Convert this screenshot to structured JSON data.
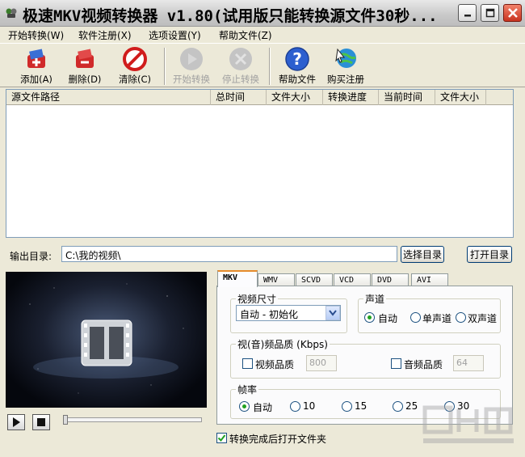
{
  "window": {
    "title": "极速MKV视频转换器 v1.80(试用版只能转换源文件30秒..."
  },
  "menu": {
    "items": [
      "开始转换(W)",
      "软件注册(X)",
      "选项设置(Y)",
      "帮助文件(Z)"
    ]
  },
  "toolbar": {
    "add": "添加(A)",
    "delete": "删除(D)",
    "clear": "清除(C)",
    "start": "开始转换",
    "stop": "停止转换",
    "help": "帮助文件",
    "buy": "购买注册"
  },
  "file_list": {
    "columns": [
      "源文件路径",
      "总时间",
      "文件大小",
      "转换进度",
      "当前时间",
      "文件大小"
    ],
    "rows": []
  },
  "output": {
    "label": "输出目录:",
    "path": "C:\\我的视频\\",
    "select_button": "选择目录",
    "open_button": "打开目录"
  },
  "tabs": [
    "MKV",
    "WMV",
    "SCVD",
    "VCD",
    "DVD",
    "AVI"
  ],
  "active_tab": "MKV",
  "video_size": {
    "title": "视频尺寸",
    "selected": "自动 - 初始化"
  },
  "channel": {
    "title": "声道",
    "options": [
      "自动",
      "单声道",
      "双声道"
    ],
    "selected": "自动"
  },
  "quality": {
    "title": "视(音)频品质 (Kbps)",
    "video_label": "视频品质",
    "video_value": "800",
    "audio_label": "音频品质",
    "audio_value": "64"
  },
  "framerate": {
    "title": "帧率",
    "options": [
      "自动",
      "10",
      "15",
      "25",
      "30"
    ],
    "selected": "自动"
  },
  "open_after": {
    "label": "转换完成后打开文件夹",
    "checked": true
  },
  "player": {
    "seek_position": 0
  },
  "colors": {
    "window_bg": "#ece9d8",
    "tab_active_accent": "#e68b2c",
    "radio_dot": "#21a121",
    "close_button": "#c8331f"
  }
}
